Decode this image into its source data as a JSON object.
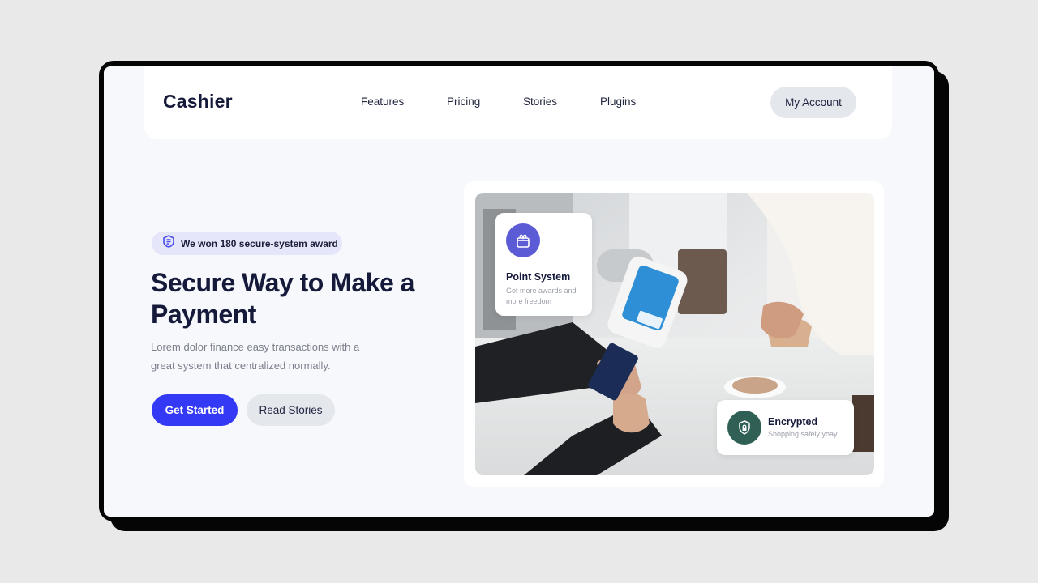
{
  "brand": {
    "name": "Cashier"
  },
  "nav": {
    "links": [
      "Features",
      "Pricing",
      "Stories",
      "Plugins"
    ],
    "account_label": "My Account"
  },
  "hero": {
    "badge_text": "We won 180 secure-system award",
    "title": "Secure Way to Make a Payment",
    "description": "Lorem dolor finance easy transactions with a great system that centralized normally.",
    "primary_cta": "Get Started",
    "secondary_cta": "Read Stories"
  },
  "cards": {
    "point_system": {
      "title": "Point System",
      "subtitle": "Got more awards and more freedom",
      "icon": "gift-icon"
    },
    "encrypted": {
      "title": "Encrypted",
      "subtitle": "Shopping safely yoay",
      "icon": "shield-lock-icon"
    }
  },
  "colors": {
    "accent": "#3439f5",
    "brand_text": "#15193a",
    "badge_bg": "#e6e6fb",
    "point_icon_bg": "#5b5bd6",
    "encrypted_icon_bg": "#2f5f55"
  }
}
